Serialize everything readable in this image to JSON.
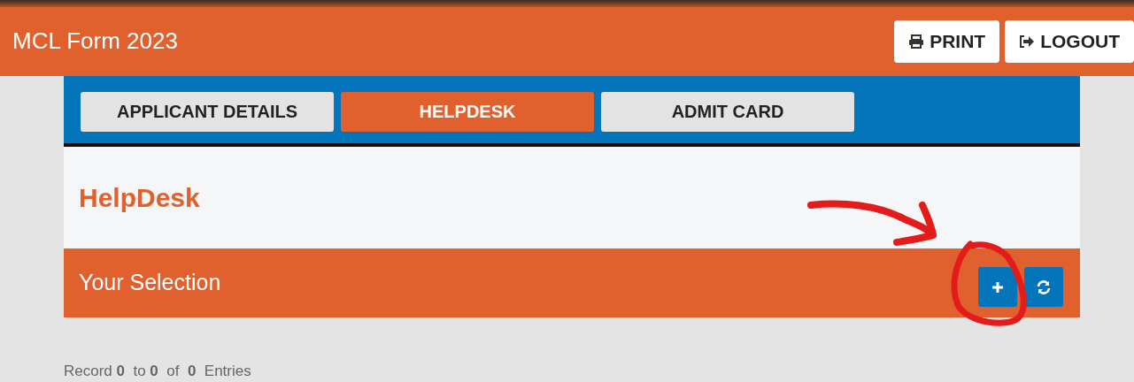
{
  "header": {
    "title": "MCL Form 2023",
    "buttons": [
      {
        "kind": "print",
        "label": "PRINT"
      },
      {
        "kind": "logout",
        "label": "LOGOUT"
      }
    ]
  },
  "tabs": [
    {
      "label": "APPLICANT DETAILS",
      "selected": false
    },
    {
      "label": "HELPDESK",
      "selected": true
    },
    {
      "label": "ADMIT CARD",
      "selected": false
    }
  ],
  "page_title": "HelpDesk",
  "section": {
    "title": "Your Selection",
    "buttons": [
      {
        "kind": "add"
      },
      {
        "kind": "refresh"
      }
    ]
  },
  "record_info": "Record **0**  to **0**  of  **0**  Entries"
}
